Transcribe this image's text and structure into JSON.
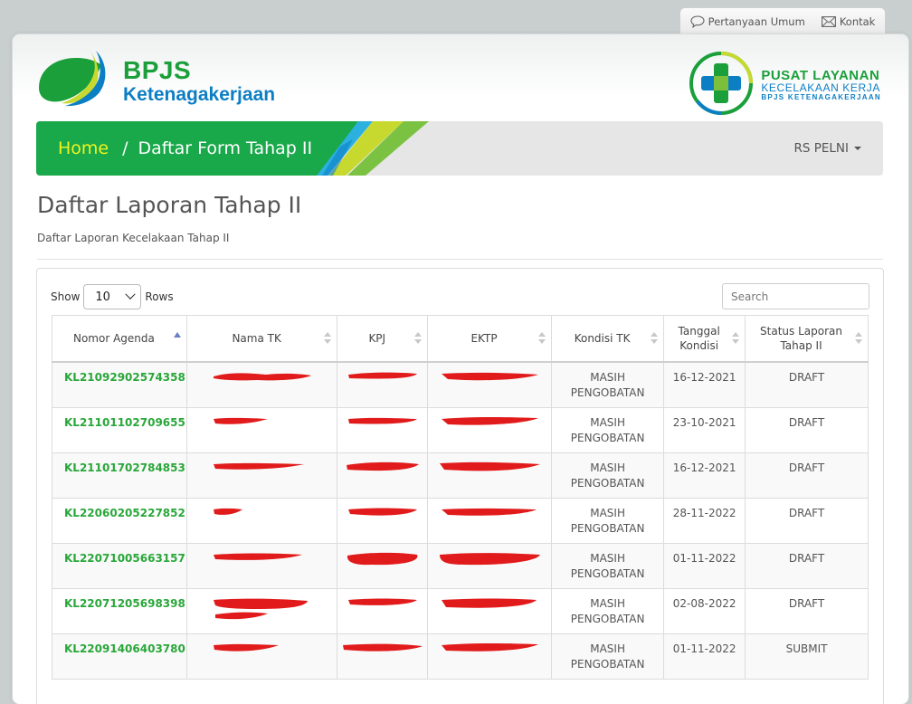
{
  "topbar": {
    "faq": "Pertanyaan Umum",
    "contact": "Kontak"
  },
  "logo": {
    "brand": "BPJS",
    "brand_sub": "Ketenagakerjaan"
  },
  "logo_right": {
    "line1": "PUSAT LAYANAN",
    "line2": "KECELAKAAN KERJA",
    "line3": "BPJS KETENAGAKERJAAN"
  },
  "breadcrumb": {
    "home": "Home",
    "separator": "/",
    "current": "Daftar Form Tahap II"
  },
  "user_menu": "RS PELNI",
  "page": {
    "title": "Daftar Laporan Tahap II",
    "subtitle": "Daftar Laporan Kecelakaan Tahap II"
  },
  "table_controls": {
    "show_label": "Show",
    "rows_value": "10",
    "rows_label": "Rows",
    "search_placeholder": "Search"
  },
  "columns": [
    "Nomor Agenda",
    "Nama TK",
    "KPJ",
    "EKTP",
    "Kondisi TK",
    "Tanggal Kondisi",
    "Status Laporan Tahap II"
  ],
  "rows": [
    {
      "agenda": "KL21092902574358",
      "kondisi": "MASIH PENGOBATAN",
      "tanggal": "16-12-2021",
      "status": "DRAFT"
    },
    {
      "agenda": "KL21101102709655",
      "kondisi": "MASIH PENGOBATAN",
      "tanggal": "23-10-2021",
      "status": "DRAFT"
    },
    {
      "agenda": "KL21101702784853",
      "kondisi": "MASIH PENGOBATAN",
      "tanggal": "16-12-2021",
      "status": "DRAFT"
    },
    {
      "agenda": "KL22060205227852",
      "kondisi": "MASIH PENGOBATAN",
      "tanggal": "28-11-2022",
      "status": "DRAFT"
    },
    {
      "agenda": "KL22071005663157",
      "kondisi": "MASIH PENGOBATAN",
      "tanggal": "01-11-2022",
      "status": "DRAFT"
    },
    {
      "agenda": "KL22071205698398",
      "kondisi": "MASIH PENGOBATAN",
      "tanggal": "02-08-2022",
      "status": "DRAFT"
    },
    {
      "agenda": "KL22091406403780",
      "kondisi": "MASIH PENGOBATAN",
      "tanggal": "01-11-2022",
      "status": "SUBMIT"
    }
  ],
  "colors": {
    "brand_green": "#1a9f3a",
    "brand_blue": "#0c7fc4",
    "link_green": "#2aa73a",
    "home_yellow": "#f0f31f",
    "redaction": "#e11b1b"
  }
}
